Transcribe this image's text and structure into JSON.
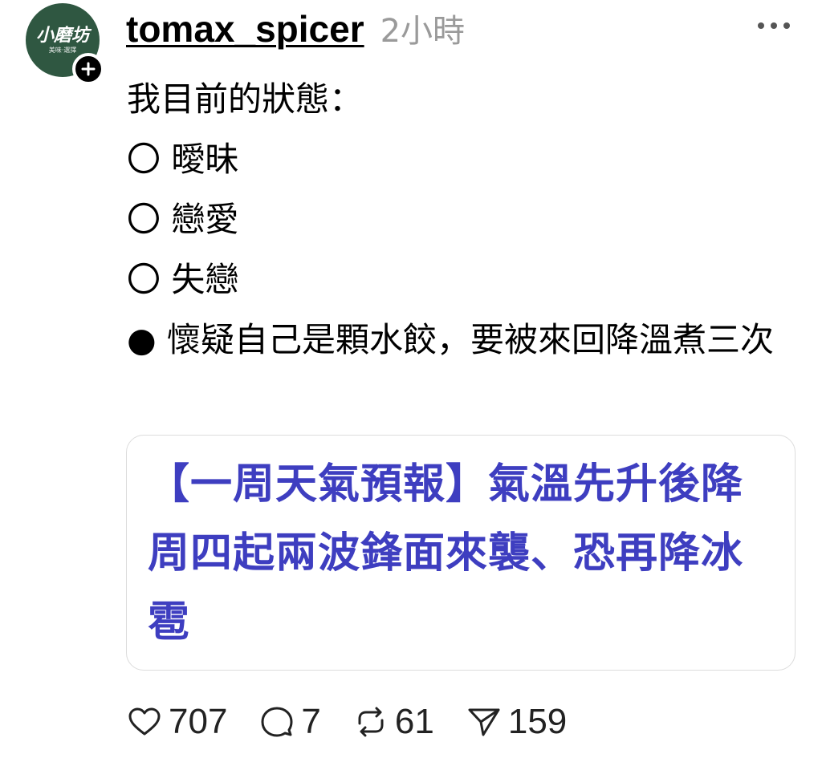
{
  "author": {
    "avatar_name": "小磨坊",
    "avatar_tagline": "美味·選擇",
    "username": "tomax_spicer",
    "time": "2小時"
  },
  "post": {
    "lines": [
      "我目前的狀態：",
      "〇 曖昧",
      "〇 戀愛",
      "〇 失戀",
      "● 懷疑自己是顆水餃，要被來回降溫煮三次"
    ]
  },
  "link_card": {
    "text": "【一周天氣預報】氣溫先升後降 周四起兩波鋒面來襲、恐再降冰雹"
  },
  "actions": {
    "likes": "707",
    "comments": "7",
    "reposts": "61",
    "shares": "159"
  },
  "icons": {
    "follow": "plus-icon",
    "more": "more-horizontal-icon",
    "like": "heart-icon",
    "comment": "comment-icon",
    "repost": "repost-icon",
    "share": "send-icon"
  },
  "colors": {
    "avatar_bg": "#2f5741",
    "link_text": "#3e3ec0",
    "muted": "#9a9a9a"
  }
}
